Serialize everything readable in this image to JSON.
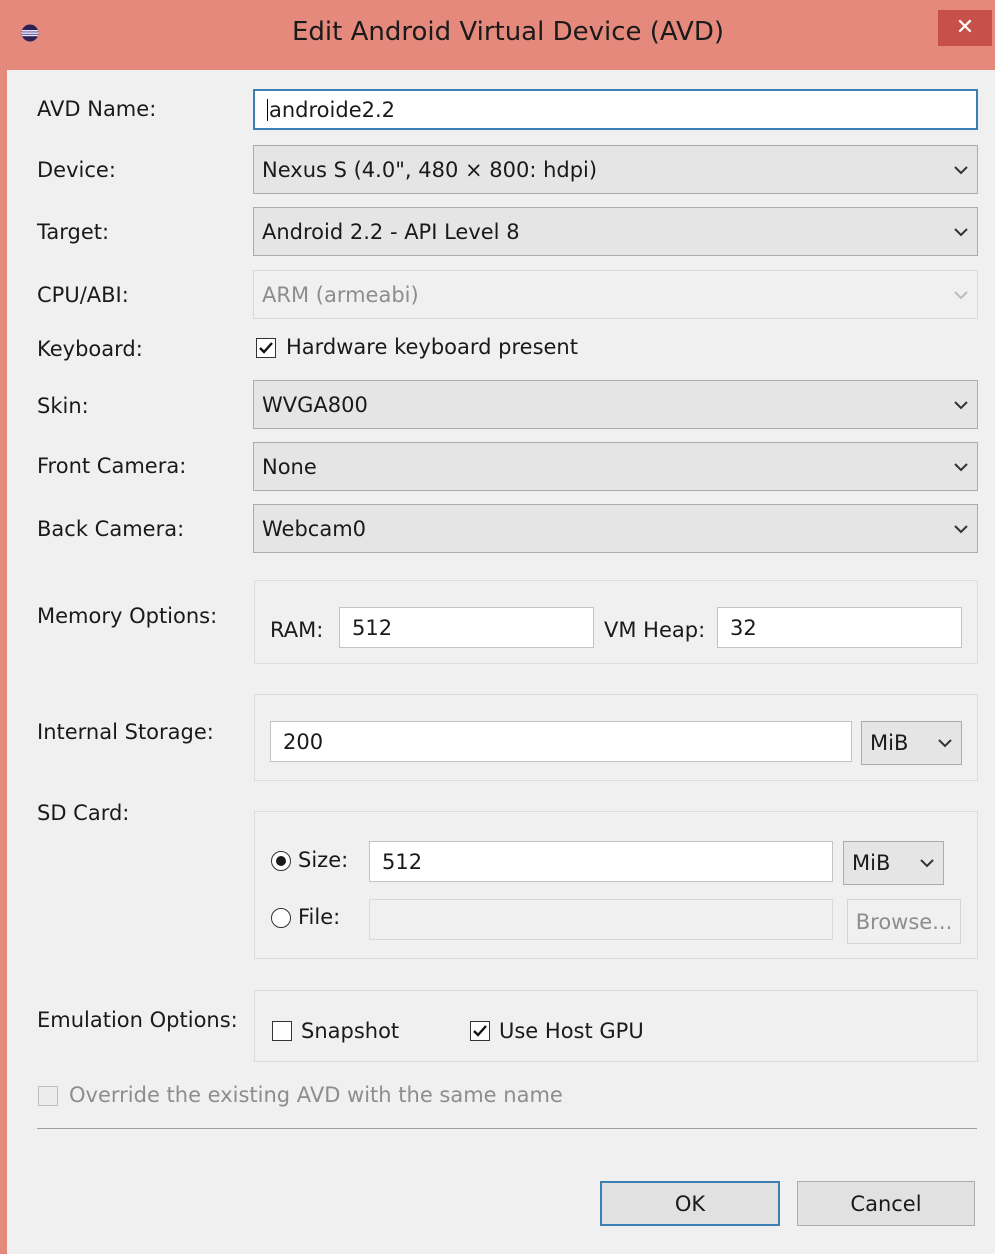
{
  "window": {
    "title": "Edit Android Virtual Device (AVD)",
    "close_glyph": "✕",
    "title_color": "#e4897b"
  },
  "form": {
    "avd_name": {
      "label": "AVD Name:",
      "value": "androide2.2"
    },
    "device": {
      "label": "Device:",
      "value": "Nexus S (4.0\", 480 × 800: hdpi)"
    },
    "target": {
      "label": "Target:",
      "value": "Android 2.2 - API Level 8"
    },
    "cpu_abi": {
      "label": "CPU/ABI:",
      "value": "ARM (armeabi)"
    },
    "keyboard": {
      "label": "Keyboard:",
      "option_label": "Hardware keyboard present",
      "checked": true
    },
    "skin": {
      "label": "Skin:",
      "value": "WVGA800"
    },
    "front_camera": {
      "label": "Front Camera:",
      "value": "None"
    },
    "back_camera": {
      "label": "Back Camera:",
      "value": "Webcam0"
    },
    "memory": {
      "label": "Memory Options:",
      "ram_label": "RAM:",
      "ram_value": "512",
      "vm_heap_label": "VM Heap:",
      "vm_heap_value": "32"
    },
    "internal_storage": {
      "label": "Internal Storage:",
      "value": "200",
      "unit": "MiB"
    },
    "sd_card": {
      "label": "SD Card:",
      "size_label": "Size:",
      "size_value": "512",
      "size_unit": "MiB",
      "size_selected": true,
      "file_label": "File:",
      "file_value": "",
      "browse_label": "Browse..."
    },
    "emulation": {
      "label": "Emulation Options:",
      "snapshot_label": "Snapshot",
      "snapshot_checked": false,
      "host_gpu_label": "Use Host GPU",
      "host_gpu_checked": true
    },
    "override": {
      "label": "Override the existing AVD with the same name",
      "checked": false
    }
  },
  "buttons": {
    "ok": "OK",
    "cancel": "Cancel"
  }
}
